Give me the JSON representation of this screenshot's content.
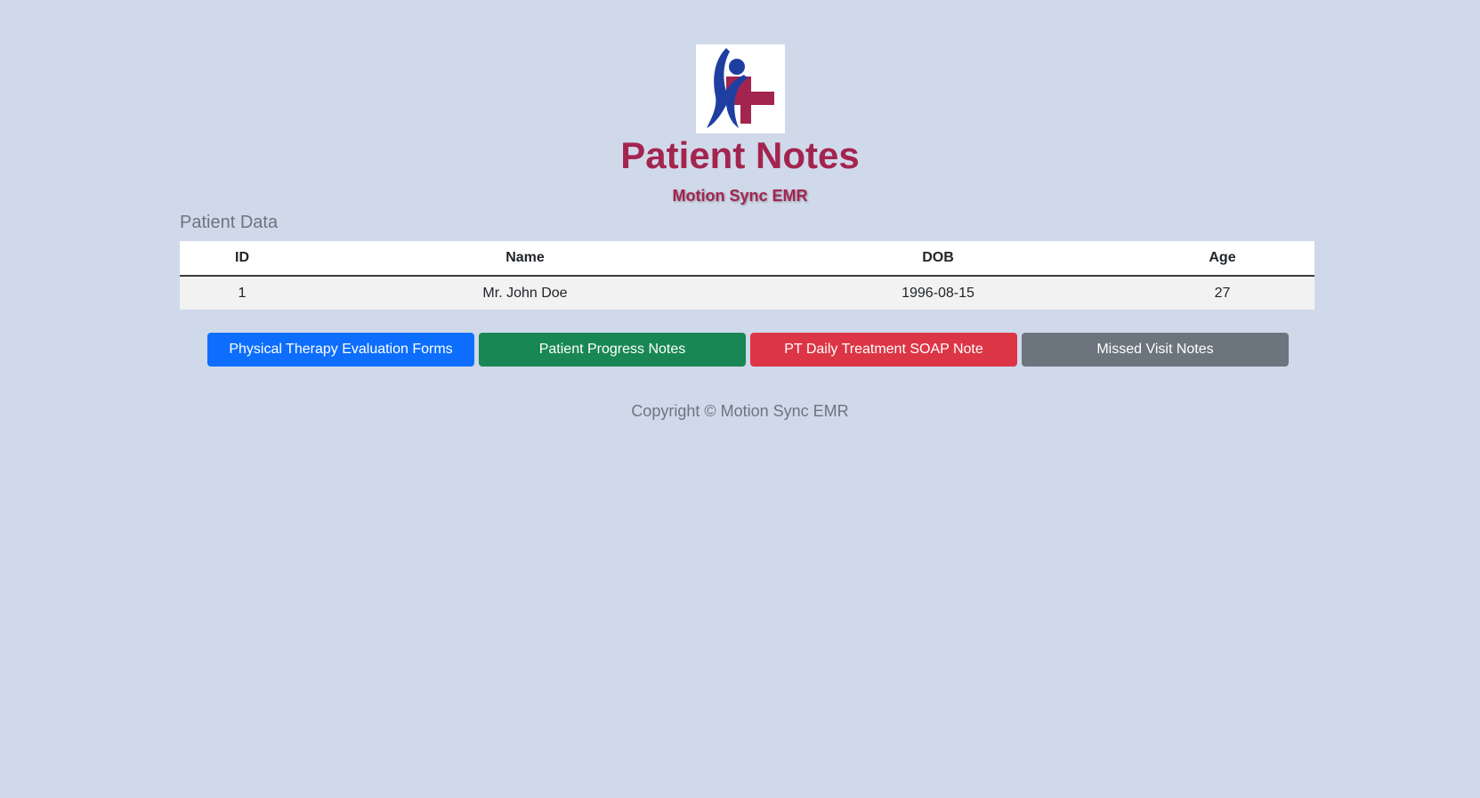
{
  "header": {
    "logo_icon": "person-medical-cross-logo",
    "title": "Patient Notes",
    "subtitle": "Motion Sync EMR"
  },
  "patient_section": {
    "label": "Patient Data",
    "columns": [
      "ID",
      "Name",
      "DOB",
      "Age"
    ],
    "rows": [
      [
        "1",
        "Mr. John Doe",
        "1996-08-15",
        "27"
      ]
    ]
  },
  "actions": {
    "evaluation_forms": "Physical Therapy Evaluation Forms",
    "progress_notes": "Patient Progress Notes",
    "soap_note": "PT Daily Treatment SOAP Note",
    "missed_visit": "Missed Visit Notes"
  },
  "footer": {
    "copyright": "Copyright © Motion Sync EMR"
  },
  "colors": {
    "background": "#d0d9ea",
    "brand": "#a3254f",
    "logo_blue": "#1f3fa0",
    "primary": "#0d6efd",
    "success": "#198754",
    "danger": "#dc3545",
    "secondary": "#6c757d"
  }
}
